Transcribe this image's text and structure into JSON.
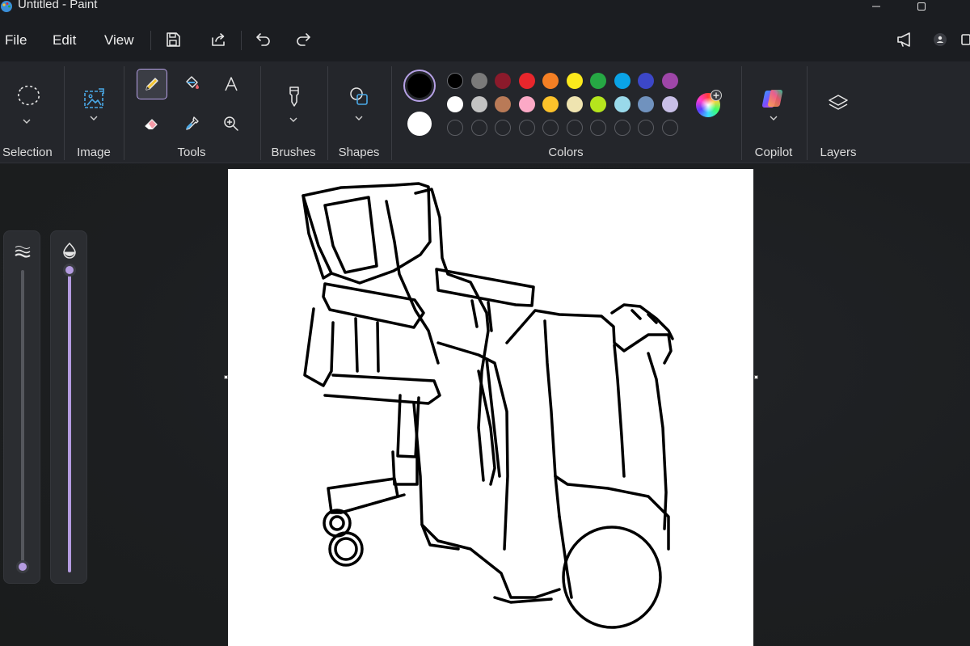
{
  "window": {
    "title": "Untitled - Paint"
  },
  "menu": {
    "file": "File",
    "edit": "Edit",
    "view": "View"
  },
  "ribbon": {
    "groups": {
      "selection": "Selection",
      "image": "Image",
      "tools": "Tools",
      "brushes": "Brushes",
      "shapes": "Shapes",
      "colors": "Colors",
      "copilot": "Copilot",
      "layers": "Layers"
    },
    "active_tool": "pencil",
    "primary_color": "#000000",
    "secondary_color": "#ffffff",
    "palette_row1": [
      "#000000",
      "#7a7a7a",
      "#8b1a2b",
      "#e8262c",
      "#f47f24",
      "#fbe91c",
      "#26a844",
      "#0aa3e6",
      "#3c47c8",
      "#9e46a8"
    ],
    "palette_row2": [
      "#ffffff",
      "#c3c3c3",
      "#b97a57",
      "#fca9c6",
      "#fdc22a",
      "#efe4b0",
      "#b5e51d",
      "#99d9ea",
      "#7092be",
      "#c8bfe7"
    ],
    "custom_slots": 10
  },
  "sliders": {
    "size": {
      "value_fraction": 0.02
    },
    "opacity": {
      "value_fraction": 1.0
    }
  },
  "icons": {
    "app": "paint-palette-icon",
    "save": "save-icon",
    "share": "share-icon",
    "undo": "undo-icon",
    "redo": "redo-icon",
    "feedback": "megaphone-icon",
    "account": "person-icon"
  }
}
